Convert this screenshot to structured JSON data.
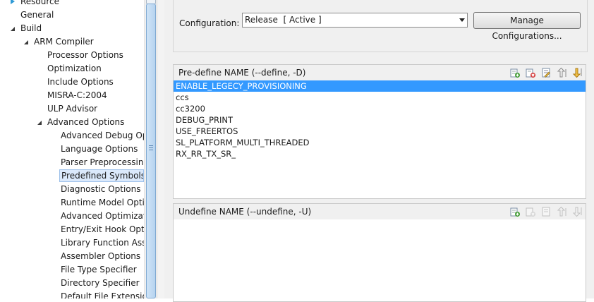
{
  "tree": {
    "items": [
      {
        "label": "Resource",
        "depth": 1,
        "twisty": "closed"
      },
      {
        "label": "General",
        "depth": 1,
        "twisty": "none"
      },
      {
        "label": "Build",
        "depth": 1,
        "twisty": "open"
      },
      {
        "label": "ARM Compiler",
        "depth": 2,
        "twisty": "open"
      },
      {
        "label": "Processor Options",
        "depth": 3,
        "twisty": "none"
      },
      {
        "label": "Optimization",
        "depth": 3,
        "twisty": "none"
      },
      {
        "label": "Include Options",
        "depth": 3,
        "twisty": "none"
      },
      {
        "label": "MISRA-C:2004",
        "depth": 3,
        "twisty": "none"
      },
      {
        "label": "ULP Advisor",
        "depth": 3,
        "twisty": "none"
      },
      {
        "label": "Advanced Options",
        "depth": 3,
        "twisty": "open"
      },
      {
        "label": "Advanced Debug Op",
        "depth": 4,
        "twisty": "none"
      },
      {
        "label": "Language Options",
        "depth": 4,
        "twisty": "none"
      },
      {
        "label": "Parser Preprocessing",
        "depth": 4,
        "twisty": "none"
      },
      {
        "label": "Predefined Symbols",
        "depth": 4,
        "twisty": "none",
        "selected": true
      },
      {
        "label": "Diagnostic Options",
        "depth": 4,
        "twisty": "none"
      },
      {
        "label": "Runtime Model Optio",
        "depth": 4,
        "twisty": "none"
      },
      {
        "label": "Advanced Optimizati",
        "depth": 4,
        "twisty": "none"
      },
      {
        "label": "Entry/Exit Hook Optic",
        "depth": 4,
        "twisty": "none"
      },
      {
        "label": "Library Function Assu",
        "depth": 4,
        "twisty": "none"
      },
      {
        "label": "Assembler Options",
        "depth": 4,
        "twisty": "none"
      },
      {
        "label": "File Type Specifier",
        "depth": 4,
        "twisty": "none"
      },
      {
        "label": "Directory Specifier",
        "depth": 4,
        "twisty": "none"
      },
      {
        "label": "Default File Extensior",
        "depth": 4,
        "twisty": "none"
      }
    ]
  },
  "configuration": {
    "label": "Configuration:",
    "selected": "Release  [ Active ]",
    "manage_label": "Manage Configurations..."
  },
  "define": {
    "title": "Pre-define NAME (--define, -D)",
    "items": [
      {
        "value": "ENABLE_LEGECY_PROVISIONING",
        "selected": true
      },
      {
        "value": "ccs"
      },
      {
        "value": "cc3200"
      },
      {
        "value": "DEBUG_PRINT"
      },
      {
        "value": "USE_FREERTOS"
      },
      {
        "value": "SL_PLATFORM_MULTI_THREADED"
      },
      {
        "value": "RX_RR_TX_SR_"
      }
    ]
  },
  "undefine": {
    "title": "Undefine NAME (--undefine, -U)",
    "items": []
  },
  "toolbar_icons": [
    "add-icon",
    "delete-icon",
    "edit-icon",
    "move-up-icon",
    "move-down-icon"
  ],
  "colors": {
    "selection": "#3399ff",
    "tree_selection": "#dbe9fb",
    "panel_bg": "#f0f0f0"
  }
}
